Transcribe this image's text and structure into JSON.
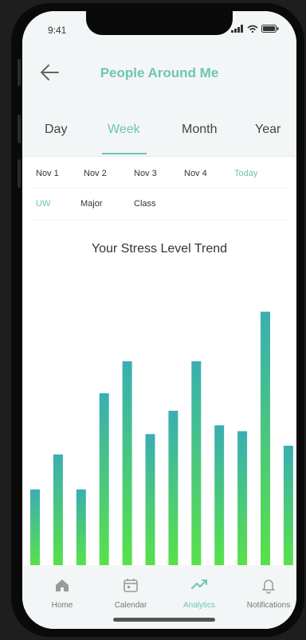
{
  "status": {
    "time": "9:41"
  },
  "header": {
    "title": "People Around Me"
  },
  "tabs": [
    {
      "label": "Day",
      "active": false
    },
    {
      "label": "Week",
      "active": true
    },
    {
      "label": "Month",
      "active": false
    },
    {
      "label": "Year",
      "active": false
    }
  ],
  "dates": [
    {
      "label": "Nov 1"
    },
    {
      "label": "Nov 2"
    },
    {
      "label": "Nov 3"
    },
    {
      "label": "Nov 4"
    },
    {
      "label": "Today",
      "active": true
    }
  ],
  "filters": [
    {
      "label": "UW",
      "active": true
    },
    {
      "label": "Major"
    },
    {
      "label": "Class"
    }
  ],
  "chart_data": {
    "type": "bar",
    "title": "Your Stress Level Trend",
    "values": [
      26,
      38,
      26,
      59,
      70,
      45,
      53,
      70,
      48,
      46,
      87,
      41
    ],
    "ylim": [
      0,
      100
    ],
    "colors": {
      "top": "#3aaeb2",
      "bottom": "#58e14a"
    }
  },
  "tabbar": [
    {
      "label": "Home",
      "icon": "home-icon"
    },
    {
      "label": "Calendar",
      "icon": "calendar-icon"
    },
    {
      "label": "Analytics",
      "icon": "analytics-icon",
      "active": true
    },
    {
      "label": "Notifications",
      "icon": "bell-icon"
    }
  ],
  "colors": {
    "accent": "#6cc6b0"
  }
}
